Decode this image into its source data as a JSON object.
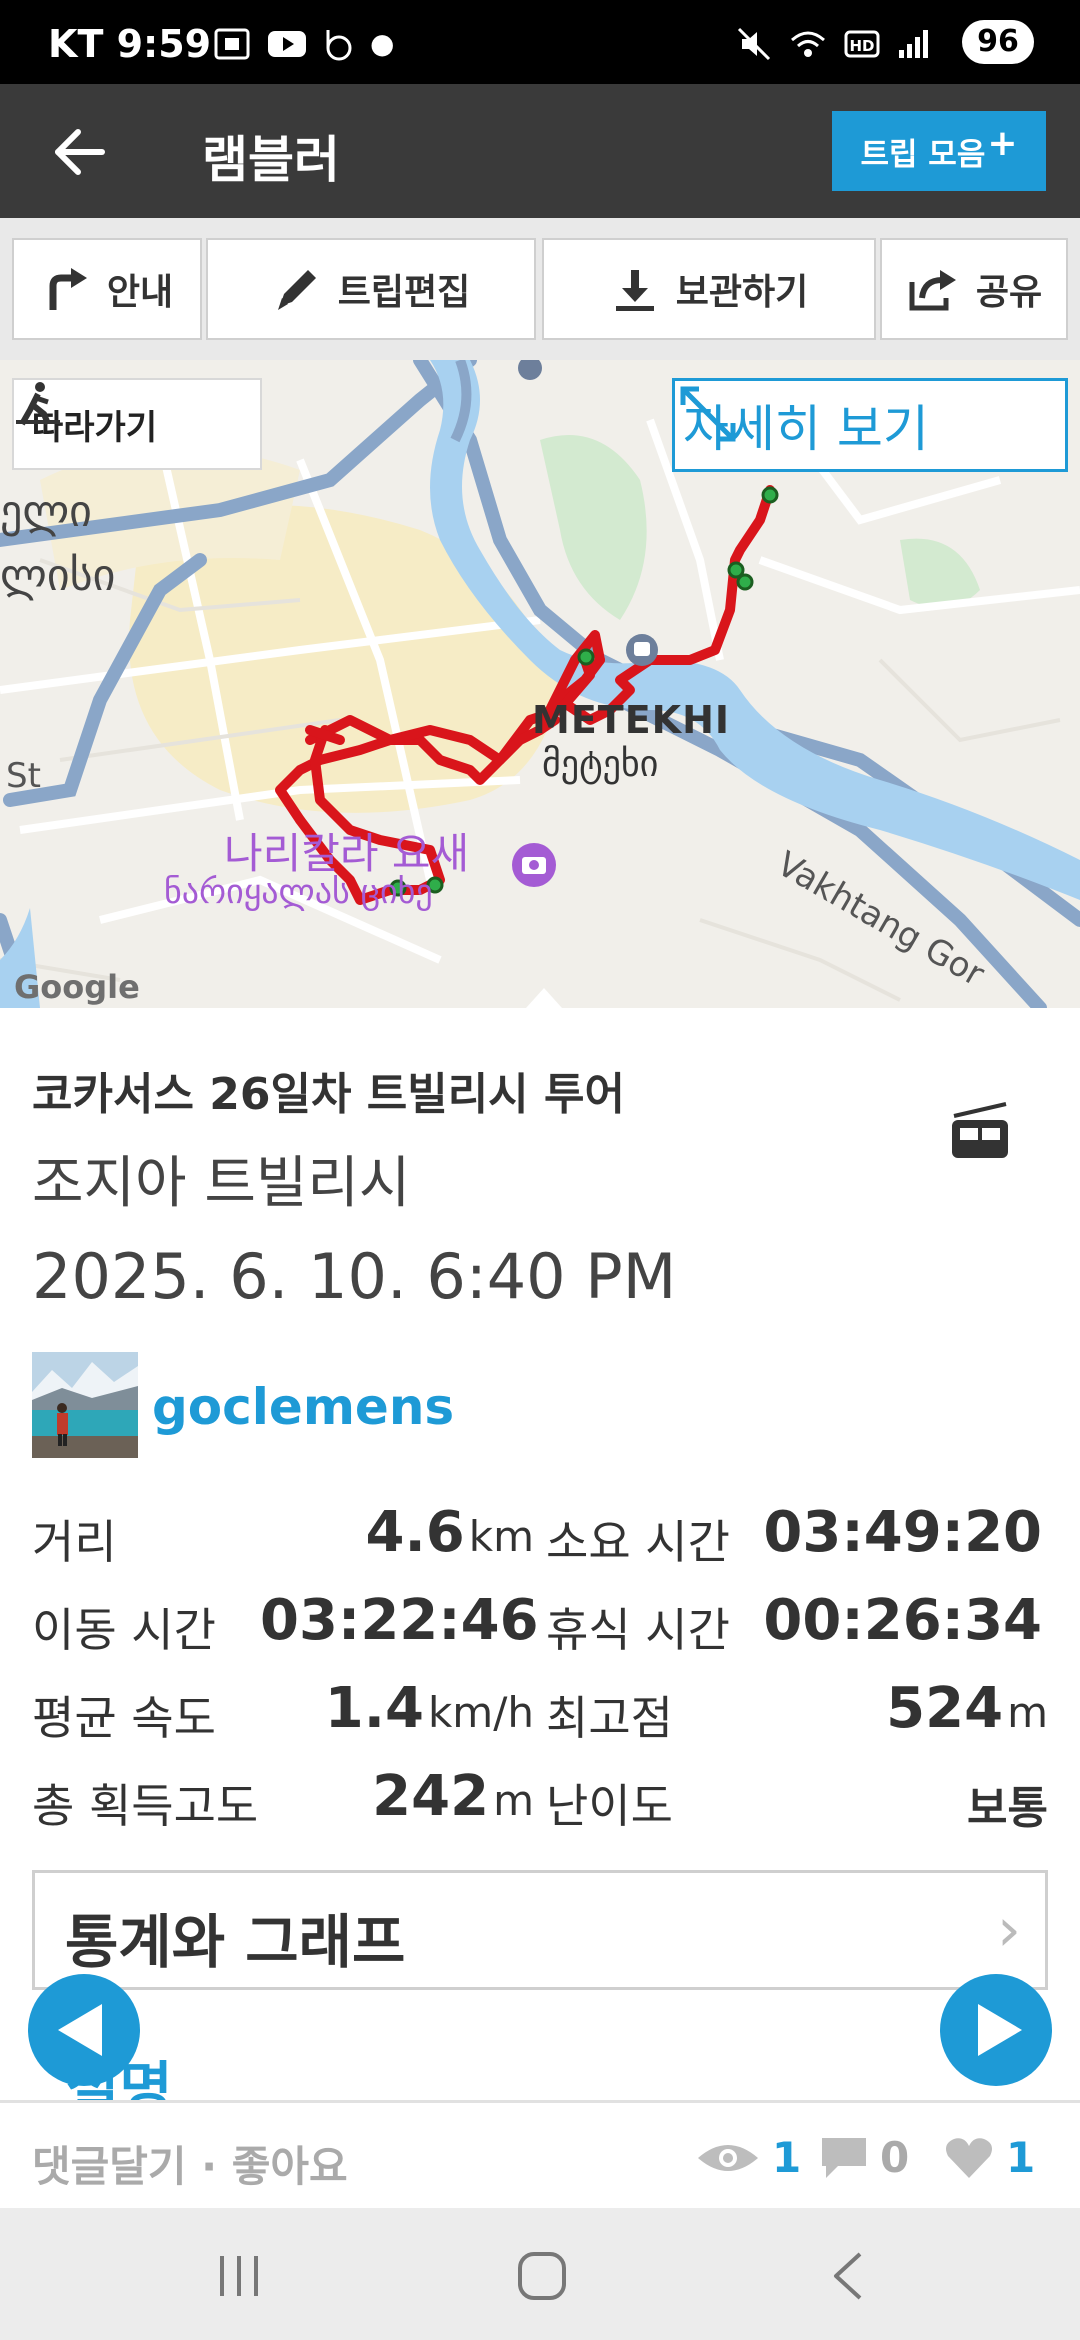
{
  "status_bar": {
    "carrier_time": "KT 9:59",
    "battery": "96"
  },
  "app_bar": {
    "title": "램블러",
    "trip_collection": "트립 모음"
  },
  "toolbar": {
    "guide": "안내",
    "edit": "트립편집",
    "save": "보관하기",
    "share": "공유"
  },
  "map": {
    "follow": "따라가기",
    "detail": "자세히 보기",
    "labels": {
      "metekhi": "METEKHI",
      "metekhi_geo": "მეტეხი",
      "narikala": "나리칼라 요새",
      "narikala_geo": "ნარიყალას ციხე",
      "vakhtang": "Vakhtang Gor",
      "st": "St",
      "geo1": "ელი",
      "geo2": "ლისი",
      "google": "Google"
    }
  },
  "trip": {
    "name": "코카서스 26일차 트빌리시 투어",
    "location": "조지아 트빌리시",
    "date": "2025. 6. 10. 6:40 PM",
    "user": "goclemens"
  },
  "stats": {
    "distance": {
      "label": "거리",
      "value": "4.6",
      "unit": "km"
    },
    "duration": {
      "label": "소요 시간",
      "value": "03:49:20"
    },
    "moving": {
      "label": "이동 시간",
      "value": "03:22:46"
    },
    "rest": {
      "label": "휴식 시간",
      "value": "00:26:34"
    },
    "avg_speed": {
      "label": "평균 속도",
      "value": "1.4",
      "unit": "km/h"
    },
    "highest": {
      "label": "최고점",
      "value": "524",
      "unit": "m"
    },
    "gain": {
      "label": "총 획득고도",
      "value": "242",
      "unit": "m"
    },
    "difficulty": {
      "label": "난이도",
      "value": "보통"
    }
  },
  "stats_graph": {
    "label": "통계와 그래프",
    "chevron": "›"
  },
  "description_peek": "설명",
  "bottom_bar": {
    "comments_likes": "댓글달기 · 좋아요",
    "views": "1",
    "comments": "0",
    "likes": "1"
  },
  "colors": {
    "accent": "#1e9ad6",
    "route": "#d9151b",
    "appbar": "#3a3a3a"
  }
}
